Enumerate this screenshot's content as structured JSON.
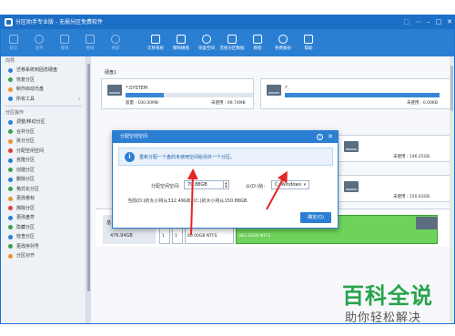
{
  "window": {
    "title": "分区助手专业版 - 无损分区免费软件",
    "controls": [
      "⬚",
      "⋯",
      "–",
      "□",
      "✕"
    ]
  },
  "toolbar": {
    "items": [
      {
        "label": "提交",
        "icon": "check-icon",
        "dim": true
      },
      {
        "label": "放弃",
        "icon": "undo-icon",
        "dim": true
      },
      {
        "label": "撤销",
        "icon": "back-icon",
        "dim": true
      },
      {
        "label": "重做",
        "icon": "redo-icon",
        "dim": true
      },
      {
        "label": "刷新",
        "icon": "refresh-icon",
        "dim": true
      },
      {
        "label": "迁移系统",
        "icon": "migrate-icon",
        "dim": false
      },
      {
        "label": "擦除磁盘",
        "icon": "erase-icon",
        "dim": false
      },
      {
        "label": "恢复空间",
        "icon": "recover-icon",
        "dim": false
      },
      {
        "label": "无损分区数据",
        "icon": "partition-icon",
        "dim": false
      },
      {
        "label": "教程",
        "icon": "book-icon",
        "dim": false
      },
      {
        "label": "免费备份",
        "icon": "backup-icon",
        "dim": false
      },
      {
        "label": "帮助",
        "icon": "help-icon",
        "dim": false
      }
    ]
  },
  "sidebar": {
    "wizard_header": "向导",
    "wizard_items": [
      "迁移系统到固态硬盘",
      "恢复分区",
      "制作启动光盘",
      "所有工具"
    ],
    "ops_header": "分区操作",
    "ops_items": [
      "调整/移动分区",
      "合并分区",
      "拆分分区",
      "分配空闲空间",
      "克隆分区",
      "创建分区",
      "删除分区",
      "格式化分区",
      "更改卷标",
      "擦除分区",
      "更改盘符",
      "隐藏分区",
      "检查分区",
      "更改序列号",
      "分区对齐"
    ]
  },
  "main": {
    "disk_label": "硬盘1",
    "partitions": [
      {
        "name": "*:SYSTEM",
        "capacity": "容量 : 100.00MB",
        "free": "未使用 : 69.74MB",
        "fill": 0.3
      },
      {
        "name": "*:",
        "capacity": "",
        "free": "未使用 : 0.00KB",
        "fill": 1.0
      },
      {
        "name": "",
        "capacity": "",
        "free": "未使用 : 146.25GB",
        "fill": 0.1
      },
      {
        "name": "",
        "capacity": "",
        "free": "未使用 : 150.63GB",
        "fill": 0.1
      }
    ],
    "diskmap": {
      "basic_label": "基",
      "size": "476.94GB",
      "segments": [
        "1",
        "1",
        "80.00GB NTFS",
        "383.30GB NTFS"
      ]
    }
  },
  "dialog": {
    "title": "分配空闲空间",
    "info": "重新分配一个盘的未使用空间给另外一个分区。",
    "size_label": "分配空闲空间:",
    "size_value": "70.88GB",
    "from_label": "从(D:)给:",
    "from_value": "C: Windows",
    "note": "当前(D:)的大小将从312.49GB, (C:)的大小将从150.88GB.",
    "ok_label": "确定(O)"
  },
  "watermark": {
    "title": "百科全说",
    "subtitle": "助你轻松解决"
  },
  "colors": {
    "accent": "#2b7fd3",
    "arrow": "#e32626",
    "watermark": "#27a34c"
  }
}
